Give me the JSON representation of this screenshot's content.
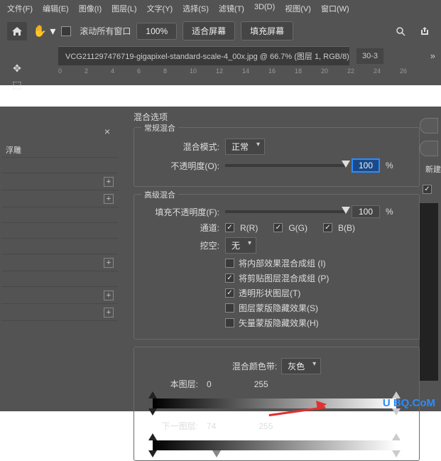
{
  "menubar": [
    "文件(F)",
    "编辑(E)",
    "图像(I)",
    "图层(L)",
    "文字(Y)",
    "选择(S)",
    "滤镜(T)",
    "3D(D)",
    "视图(V)",
    "窗口(W)"
  ],
  "toolbar": {
    "scroll_all": "滚动所有窗口",
    "zoom": "100%",
    "fit_screen": "适合屏幕",
    "fill_screen": "填充屏幕"
  },
  "tabs": {
    "active": "VCG211297476719-gigapixel-standard-scale-4_00x.jpg @ 66.7% (图层 1, RGB/8) *",
    "second": "30-3",
    "more": "»"
  },
  "ruler": [
    "0",
    "2",
    "4",
    "6",
    "8",
    "10",
    "12",
    "14",
    "16",
    "18",
    "20",
    "22",
    "24",
    "26"
  ],
  "left_items": {
    "relief": "浮雕"
  },
  "dlg": {
    "title": "混合选项",
    "general": {
      "legend": "常规混合",
      "blend_mode_lbl": "混合模式:",
      "blend_mode_val": "正常",
      "opacity_lbl": "不透明度(O):",
      "opacity_val": "100",
      "pct": "%"
    },
    "advanced": {
      "legend": "高级混合",
      "fill_lbl": "填充不透明度(F):",
      "fill_val": "100",
      "channels_lbl": "通道:",
      "r": "R(R)",
      "g": "G(G)",
      "b": "B(B)",
      "knockout_lbl": "挖空:",
      "knockout_val": "无",
      "opts": [
        "将内部效果混合成组 (I)",
        "将剪贴图层混合成组 (P)",
        "透明形状图层(T)",
        "图层蒙版隐藏效果(S)",
        "矢量蒙版隐藏效果(H)"
      ]
    },
    "blendif": {
      "label": "混合颜色带:",
      "value": "灰色",
      "this_lbl": "本图层:",
      "this_lo": "0",
      "this_hi": "255",
      "under_lbl": "下一图层:",
      "under_lo": "74",
      "under_hi": "255"
    },
    "right": {
      "new": "新建"
    }
  },
  "watermark": {
    "a": "U",
    "b": "i",
    "c": "BQ.CoM"
  }
}
